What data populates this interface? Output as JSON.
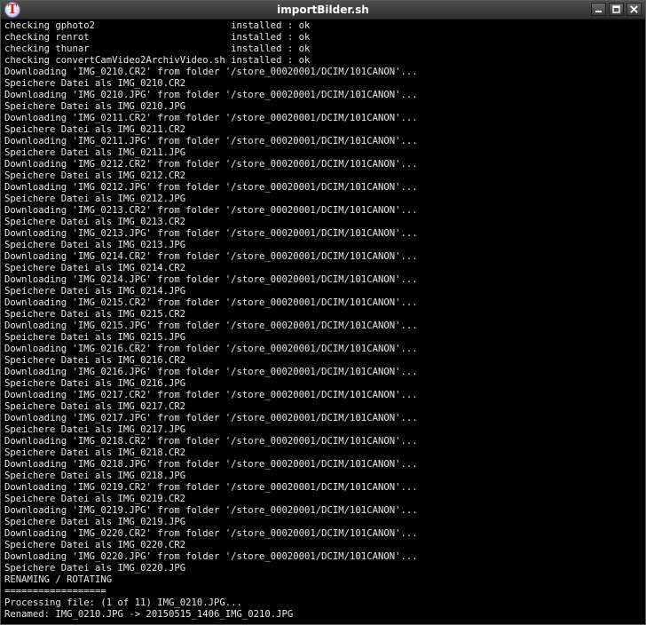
{
  "window": {
    "title": "importBilder.sh",
    "app_icon_letter": "T",
    "app_icon_color": "#d01818"
  },
  "terminal": {
    "lines": [
      "checking gphoto2                        installed : ok",
      "checking renrot                         installed : ok",
      "checking thunar                         installed : ok",
      "checking convertCamVideo2ArchivVideo.sh installed : ok",
      "Downloading 'IMG_0210.CR2' from folder '/store_00020001/DCIM/101CANON'...",
      "Speichere Datei als IMG_0210.CR2",
      "Downloading 'IMG_0210.JPG' from folder '/store_00020001/DCIM/101CANON'...",
      "Speichere Datei als IMG_0210.JPG",
      "Downloading 'IMG_0211.CR2' from folder '/store_00020001/DCIM/101CANON'...",
      "Speichere Datei als IMG_0211.CR2",
      "Downloading 'IMG_0211.JPG' from folder '/store_00020001/DCIM/101CANON'...",
      "Speichere Datei als IMG_0211.JPG",
      "Downloading 'IMG_0212.CR2' from folder '/store_00020001/DCIM/101CANON'...",
      "Speichere Datei als IMG_0212.CR2",
      "Downloading 'IMG_0212.JPG' from folder '/store_00020001/DCIM/101CANON'...",
      "Speichere Datei als IMG_0212.JPG",
      "Downloading 'IMG_0213.CR2' from folder '/store_00020001/DCIM/101CANON'...",
      "Speichere Datei als IMG_0213.CR2",
      "Downloading 'IMG_0213.JPG' from folder '/store_00020001/DCIM/101CANON'...",
      "Speichere Datei als IMG_0213.JPG",
      "Downloading 'IMG_0214.CR2' from folder '/store_00020001/DCIM/101CANON'...",
      "Speichere Datei als IMG_0214.CR2",
      "Downloading 'IMG_0214.JPG' from folder '/store_00020001/DCIM/101CANON'...",
      "Speichere Datei als IMG_0214.JPG",
      "Downloading 'IMG_0215.CR2' from folder '/store_00020001/DCIM/101CANON'...",
      "Speichere Datei als IMG_0215.CR2",
      "Downloading 'IMG_0215.JPG' from folder '/store_00020001/DCIM/101CANON'...",
      "Speichere Datei als IMG_0215.JPG",
      "Downloading 'IMG_0216.CR2' from folder '/store_00020001/DCIM/101CANON'...",
      "Speichere Datei als IMG_0216.CR2",
      "Downloading 'IMG_0216.JPG' from folder '/store_00020001/DCIM/101CANON'...",
      "Speichere Datei als IMG_0216.JPG",
      "Downloading 'IMG_0217.CR2' from folder '/store_00020001/DCIM/101CANON'...",
      "Speichere Datei als IMG_0217.CR2",
      "Downloading 'IMG_0217.JPG' from folder '/store_00020001/DCIM/101CANON'...",
      "Speichere Datei als IMG_0217.JPG",
      "Downloading 'IMG_0218.CR2' from folder '/store_00020001/DCIM/101CANON'...",
      "Speichere Datei als IMG_0218.CR2",
      "Downloading 'IMG_0218.JPG' from folder '/store_00020001/DCIM/101CANON'...",
      "Speichere Datei als IMG_0218.JPG",
      "Downloading 'IMG_0219.CR2' from folder '/store_00020001/DCIM/101CANON'...",
      "Speichere Datei als IMG_0219.CR2",
      "Downloading 'IMG_0219.JPG' from folder '/store_00020001/DCIM/101CANON'...",
      "Speichere Datei als IMG_0219.JPG",
      "Downloading 'IMG_0220.CR2' from folder '/store_00020001/DCIM/101CANON'...",
      "Speichere Datei als IMG_0220.CR2",
      "Downloading 'IMG_0220.JPG' from folder '/store_00020001/DCIM/101CANON'...",
      "Speichere Datei als IMG_0220.JPG",
      "RENAMING / ROTATING",
      "==================",
      "Processing file: (1 of 11) IMG_0210.JPG...",
      "Renamed: IMG_0210.JPG -> 20150515_1406_IMG_0210.JPG"
    ]
  },
  "icons": {
    "minimize": "minimize-icon",
    "maximize": "maximize-icon",
    "close": "close-icon"
  }
}
